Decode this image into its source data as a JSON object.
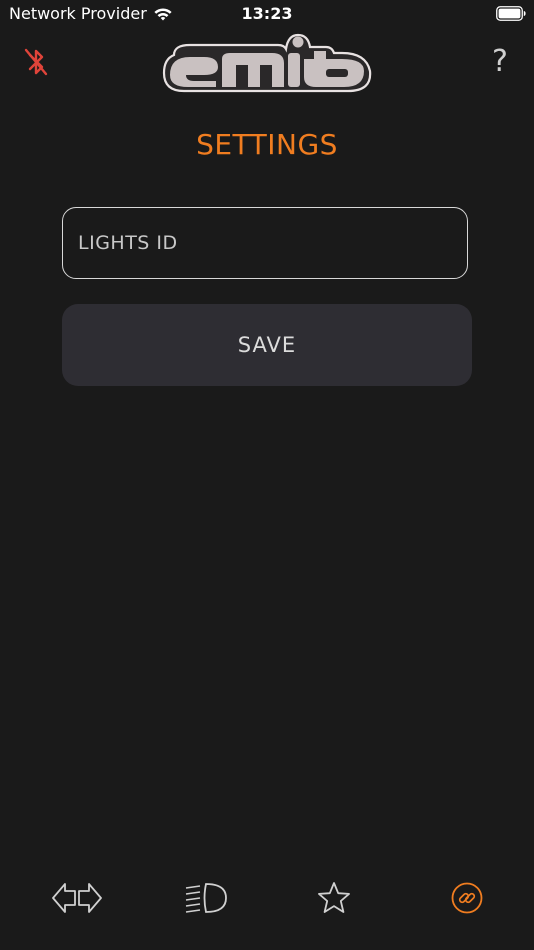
{
  "status_bar": {
    "carrier": "Network Provider",
    "time": "13:23",
    "icons": [
      "wifi-icon",
      "battery-icon"
    ]
  },
  "header": {
    "logo_alt": "emit",
    "left_icon": "bluetooth-disabled-icon",
    "right_icon": "help-icon",
    "help_glyph": "?"
  },
  "page": {
    "title": "SETTINGS"
  },
  "form": {
    "lights_id": {
      "placeholder": "LIGHTS ID",
      "value": ""
    },
    "save_label": "SAVE"
  },
  "tab_bar": {
    "tabs": [
      {
        "name": "indicators",
        "icon": "turn-signals-icon",
        "active": false
      },
      {
        "name": "lights",
        "icon": "headlight-icon",
        "active": false
      },
      {
        "name": "favorites",
        "icon": "star-icon",
        "active": false
      },
      {
        "name": "settings",
        "icon": "link-icon",
        "active": true
      }
    ]
  },
  "colors": {
    "background": "#1a1a1a",
    "accent": "#f07d20",
    "bluetooth_off": "#e0443a",
    "button_bg": "#2e2d33",
    "icon_inactive": "#d0d0d0"
  }
}
